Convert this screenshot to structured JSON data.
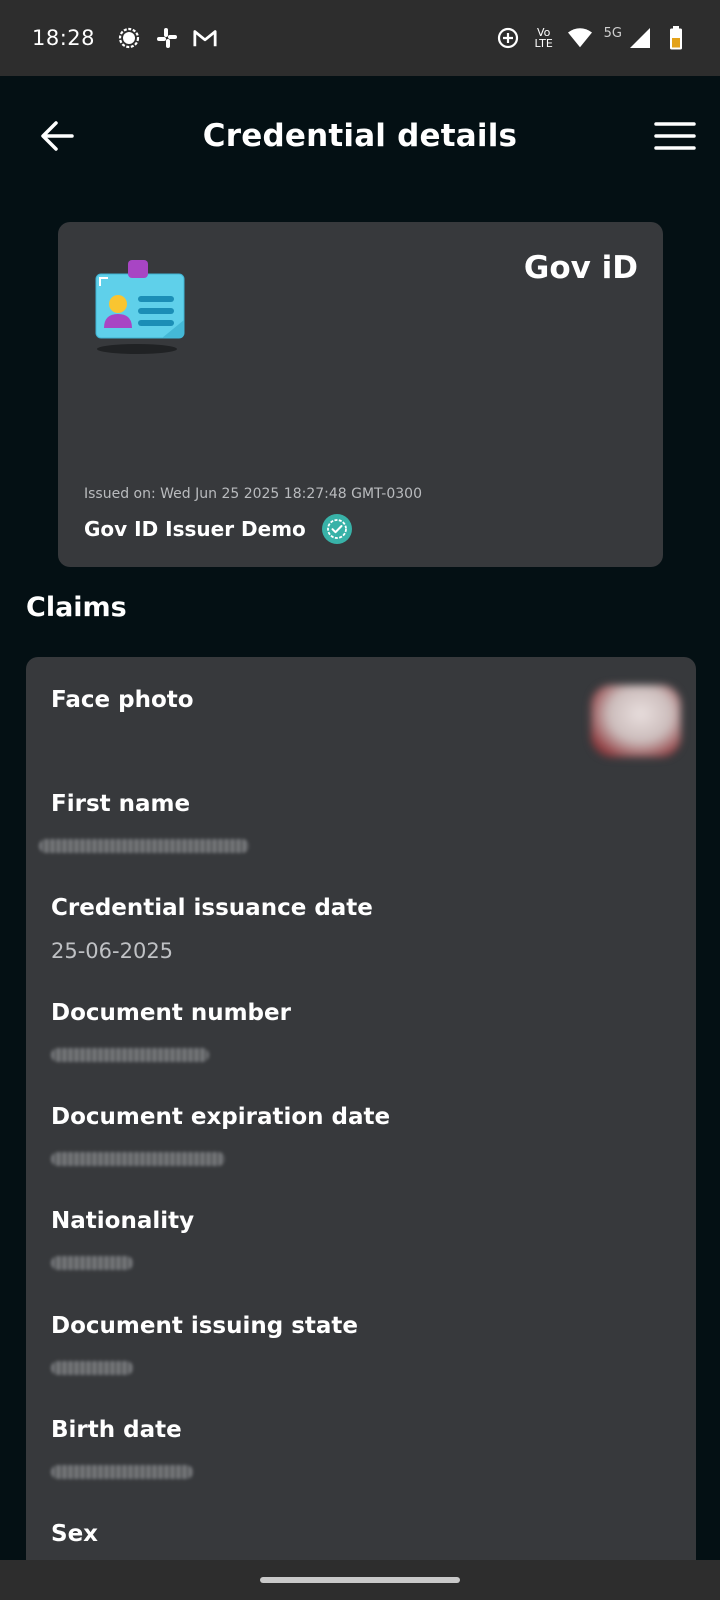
{
  "status_bar": {
    "time": "18:28",
    "left_icons": [
      "signal-app-icon",
      "slack-icon",
      "gmail-icon"
    ],
    "right_icons": [
      "data-saver-icon",
      "volte-icon",
      "wifi-icon",
      "cellular-signal-icon",
      "battery-icon"
    ],
    "volte_top": "Vo",
    "volte_bottom": "LTE",
    "network": "5G"
  },
  "app_bar": {
    "title": "Credential details",
    "back_icon": "arrow-left-icon",
    "menu_icon": "hamburger-menu-icon"
  },
  "credential": {
    "name": "Gov iD",
    "icon": "id-card-icon",
    "issued_on": "Issued on: Wed Jun 25 2025 18:27:48 GMT-0300",
    "issuer": "Gov ID Issuer Demo",
    "verified_icon": "verified-badge-icon",
    "accent": "#38b2a8"
  },
  "claims": {
    "title": "Claims",
    "items": [
      {
        "label": "Face photo"
      },
      {
        "label": "First name"
      },
      {
        "label": "Credential issuance date",
        "value": "25-06-2025"
      },
      {
        "label": "Document number"
      },
      {
        "label": "Document expiration date"
      },
      {
        "label": "Nationality"
      },
      {
        "label": "Document issuing state"
      },
      {
        "label": "Birth date"
      },
      {
        "label": "Sex"
      }
    ]
  }
}
